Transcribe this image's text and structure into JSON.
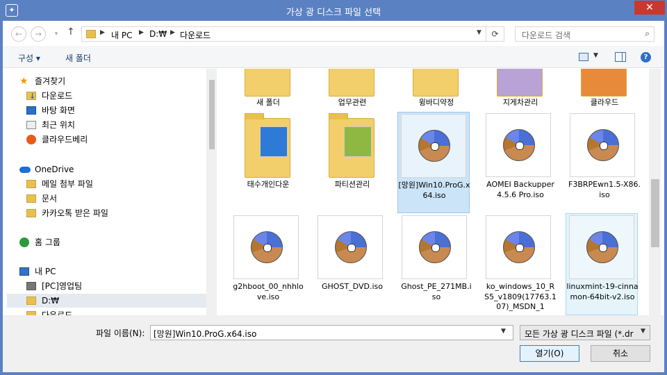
{
  "window": {
    "title": "가상 광 디스크 파일 선택",
    "app_icon": "virtualbox-icon",
    "close": "✕"
  },
  "nav_buttons": {
    "back": "←",
    "forward": "→",
    "up": "↑"
  },
  "address": {
    "crumbs": [
      "내 PC",
      "D:₩",
      "다운로드"
    ]
  },
  "search": {
    "placeholder": "다운로드 검색",
    "icon": "⌕"
  },
  "toolbar": {
    "organize": "구성 ▾",
    "new_folder": "새 폴더",
    "help": "?"
  },
  "sidebar": {
    "items": [
      {
        "label": "즐겨찾기",
        "icon": "star-icon"
      },
      {
        "label": "다운로드",
        "icon": "downloads-folder-icon"
      },
      {
        "label": "바탕 화면",
        "icon": "desktop-icon"
      },
      {
        "label": "최근 위치",
        "icon": "recent-places-icon"
      },
      {
        "label": "클라우드베리",
        "icon": "cloudberry-icon"
      },
      {
        "label": "OneDrive",
        "icon": "onedrive-icon"
      },
      {
        "label": "메일 첨부 파일",
        "icon": "folder-icon"
      },
      {
        "label": "문서",
        "icon": "folder-icon"
      },
      {
        "label": "카카오톡 받은 파일",
        "icon": "folder-icon"
      },
      {
        "label": "홈 그룹",
        "icon": "homegroup-icon"
      },
      {
        "label": "내 PC",
        "icon": "computer-icon"
      },
      {
        "label": "[PC]영업팀",
        "icon": "network-drive-icon"
      },
      {
        "label": "D:₩",
        "icon": "drive-icon"
      },
      {
        "label": "다운로드",
        "icon": "folder-icon"
      }
    ]
  },
  "files": {
    "top_row": [
      "새 폴더",
      "업무관련",
      "윙바디약정",
      "지게차관리",
      "클라우드"
    ],
    "row2": [
      {
        "name": "태수개인다운",
        "type": "folder"
      },
      {
        "name": "파티션관리",
        "type": "folder"
      },
      {
        "name": "[망원]Win10.ProG.x64.iso",
        "type": "iso"
      },
      {
        "name": "AOMEI Backupper 4.5.6 Pro.iso",
        "type": "iso"
      },
      {
        "name": "F3BRPEwn1.5-X86.iso",
        "type": "iso"
      }
    ],
    "row3": [
      {
        "name": "g2hboot_00_nhhlove.iso",
        "type": "iso"
      },
      {
        "name": "GHOST_DVD.iso",
        "type": "iso"
      },
      {
        "name": "Ghost_PE_271MB.iso",
        "type": "iso"
      },
      {
        "name": "ko_windows_10_RS5_v1809(17763.107)_MSDN_1",
        "type": "iso"
      },
      {
        "name": "linuxmint-19-cinnamon-64bit-v2.iso",
        "type": "iso"
      }
    ]
  },
  "bottom": {
    "filename_label": "파일 이름(N):",
    "filename_value": "[망원]Win10.ProG.x64.iso",
    "filter": "모든 가상 광 디스크 파일 (*.dr",
    "open": "열기(O)",
    "cancel": "취소"
  }
}
